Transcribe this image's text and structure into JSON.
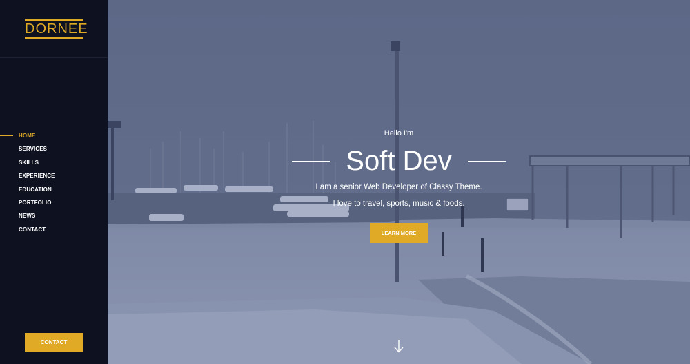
{
  "sidebar": {
    "logo": "DORNEE",
    "nav": [
      {
        "label": "HOME",
        "active": true
      },
      {
        "label": "SERVICES"
      },
      {
        "label": "SKILLS"
      },
      {
        "label": "EXPERIENCE"
      },
      {
        "label": "EDUCATION"
      },
      {
        "label": "PORTFOLIO"
      },
      {
        "label": "NEWS"
      },
      {
        "label": "CONTACT"
      }
    ],
    "contact_button": "CONTACT"
  },
  "hero": {
    "greeting": "Hello I'm",
    "title": "Soft Dev",
    "line1": "I am a senior Web Developer of Classy Theme.",
    "line2": "I love to travel, sports, music & foods.",
    "button": "LEARN MORE",
    "scroll_icon": "arrow-down-icon"
  },
  "colors": {
    "accent": "#e0aa27",
    "sidebar_bg": "#0d1120",
    "overlay": "#5f6b8a"
  }
}
